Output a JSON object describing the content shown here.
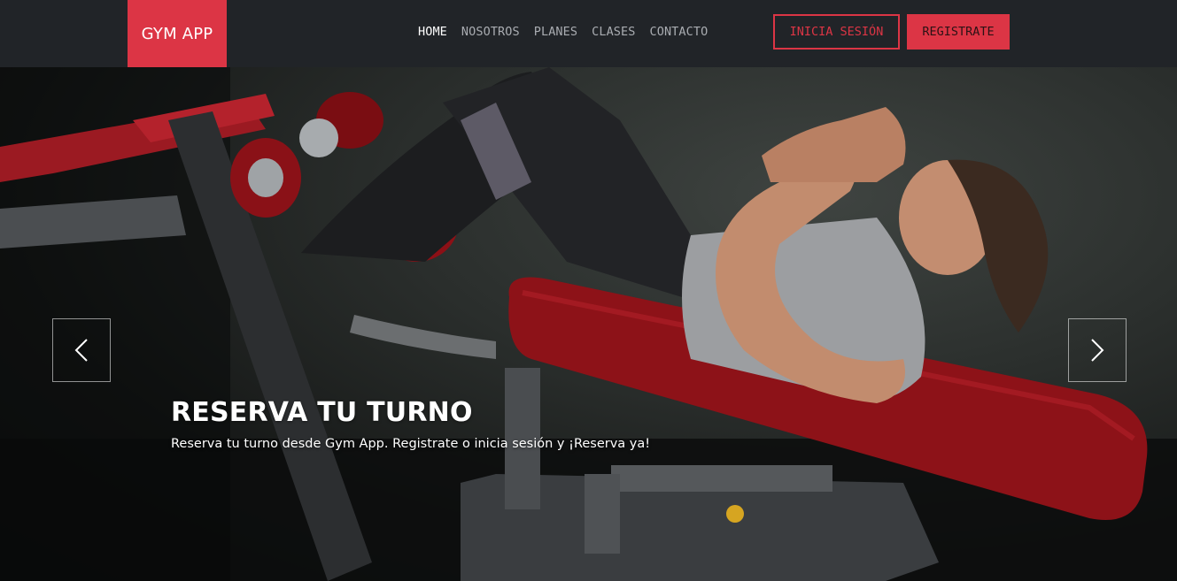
{
  "navbar": {
    "brand": "GYM APP",
    "links": [
      "HOME",
      "NOSOTROS",
      "PLANES",
      "CLASES",
      "CONTACTO"
    ],
    "active_link": "HOME",
    "login_label": "INICIA SESIÓN",
    "register_label": "REGISTRATE"
  },
  "hero": {
    "title": "RESERVA TU TURNO",
    "subtitle": "Reserva tu turno desde Gym App. Registrate o inicia sesión y ¡Reserva ya!",
    "prev_icon": "chevron-left-icon",
    "next_icon": "chevron-right-icon",
    "image_description_icon": "gym-photo"
  },
  "colors": {
    "accent": "#dc3545",
    "navbar_bg": "#212428",
    "nav_text": "#a9acb1",
    "nav_active": "#ffffff"
  }
}
